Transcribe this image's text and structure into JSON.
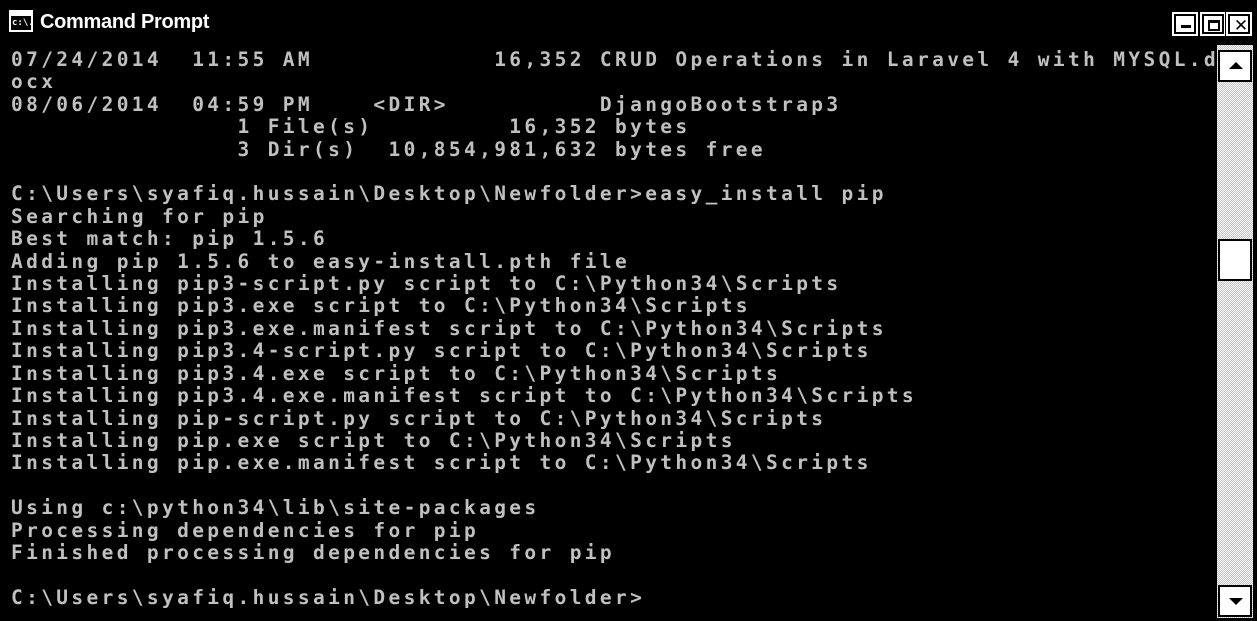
{
  "window": {
    "title": "Command Prompt",
    "icon": "cmd-icon",
    "icon_text": "c:\\."
  },
  "controls": {
    "minimize_icon": "minimize-icon",
    "maximize_icon": "maximize-icon",
    "close_icon": "close-icon",
    "close_glyph": "✕"
  },
  "console": {
    "lines": [
      "07/24/2014  11:55 AM            16,352 CRUD Operations in Laravel 4 with MYSQL.d",
      "ocx",
      "08/06/2014  04:59 PM    <DIR>          DjangoBootstrap3",
      "               1 File(s)         16,352 bytes",
      "               3 Dir(s)  10,854,981,632 bytes free",
      "",
      "C:\\Users\\syafiq.hussain\\Desktop\\Newfolder>easy_install pip",
      "Searching for pip",
      "Best match: pip 1.5.6",
      "Adding pip 1.5.6 to easy-install.pth file",
      "Installing pip3-script.py script to C:\\Python34\\Scripts",
      "Installing pip3.exe script to C:\\Python34\\Scripts",
      "Installing pip3.exe.manifest script to C:\\Python34\\Scripts",
      "Installing pip3.4-script.py script to C:\\Python34\\Scripts",
      "Installing pip3.4.exe script to C:\\Python34\\Scripts",
      "Installing pip3.4.exe.manifest script to C:\\Python34\\Scripts",
      "Installing pip-script.py script to C:\\Python34\\Scripts",
      "Installing pip.exe script to C:\\Python34\\Scripts",
      "Installing pip.exe.manifest script to C:\\Python34\\Scripts",
      "",
      "Using c:\\python34\\lib\\site-packages",
      "Processing dependencies for pip",
      "Finished processing dependencies for pip",
      "",
      "C:\\Users\\syafiq.hussain\\Desktop\\Newfolder>"
    ]
  },
  "scrollbar": {
    "up_icon": "scroll-up-arrow-icon",
    "down_icon": "scroll-down-arrow-icon",
    "position": 0.34
  },
  "colors": {
    "background": "#000000",
    "text": "#c0c0c0",
    "chrome": "#ffffff"
  }
}
